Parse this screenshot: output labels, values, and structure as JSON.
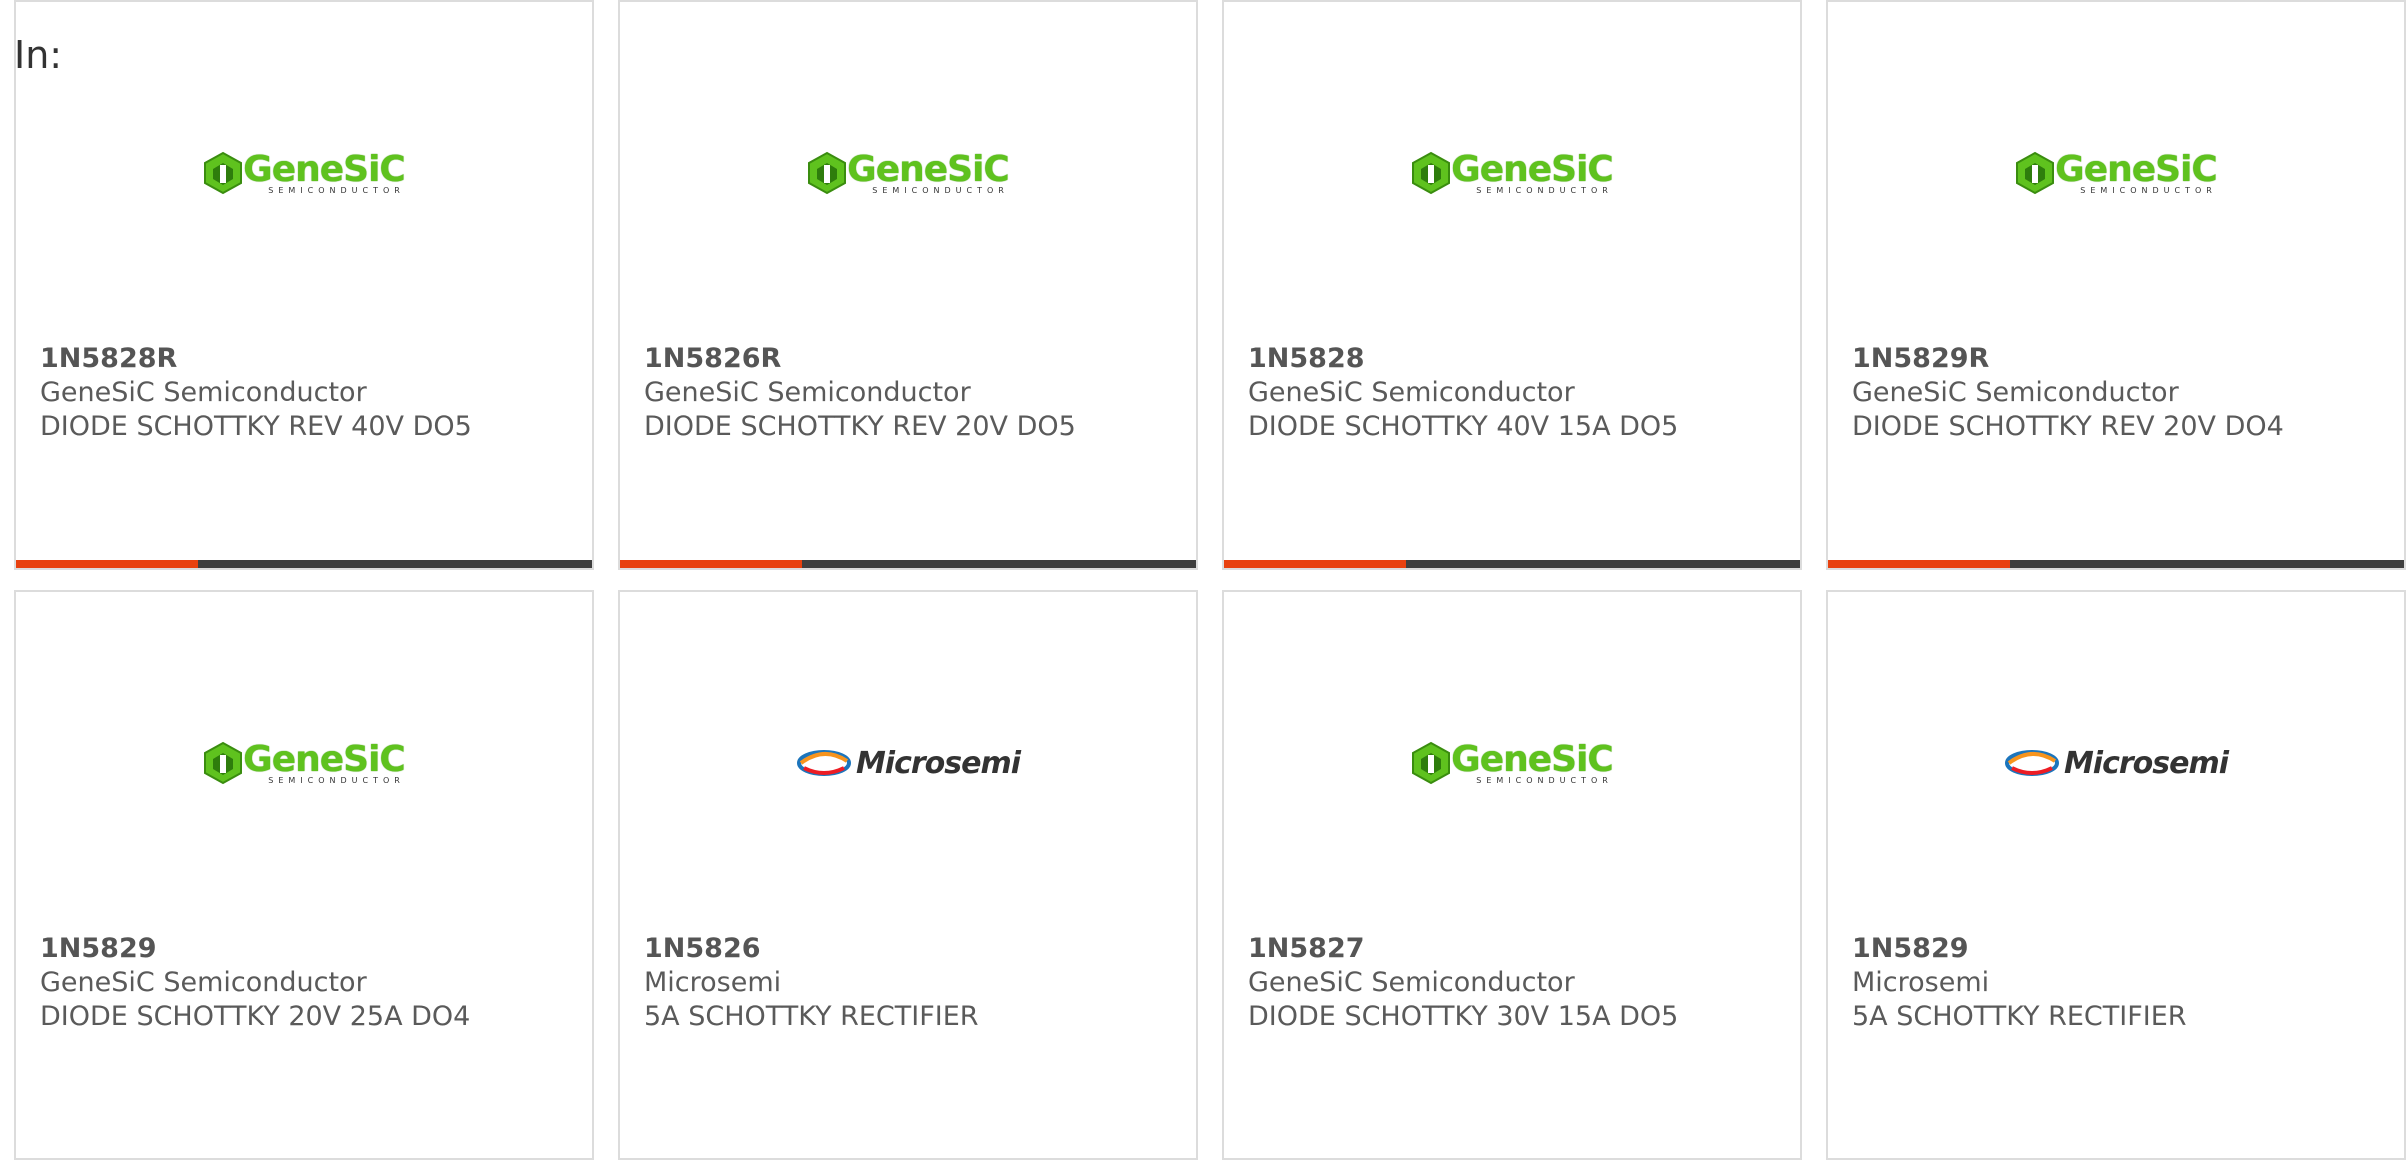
{
  "filter_label": "In:",
  "accent_color": "#e8410f",
  "bar_color": "#3f3f3f",
  "cards": [
    {
      "part": "1N5828R",
      "manufacturer": "GeneSiC Semiconductor",
      "description": "DIODE SCHOTTKY REV 40V DO5",
      "logo": "genesic-logo",
      "logo_text": "GeneSiC",
      "logo_sub": "SEMICONDUCTOR"
    },
    {
      "part": "1N5826R",
      "manufacturer": "GeneSiC Semiconductor",
      "description": "DIODE SCHOTTKY REV 20V DO5",
      "logo": "genesic-logo",
      "logo_text": "GeneSiC",
      "logo_sub": "SEMICONDUCTOR"
    },
    {
      "part": "1N5828",
      "manufacturer": "GeneSiC Semiconductor",
      "description": "DIODE SCHOTTKY 40V 15A DO5",
      "logo": "genesic-logo",
      "logo_text": "GeneSiC",
      "logo_sub": "SEMICONDUCTOR"
    },
    {
      "part": "1N5829R",
      "manufacturer": "GeneSiC Semiconductor",
      "description": "DIODE SCHOTTKY REV 20V DO4",
      "logo": "genesic-logo",
      "logo_text": "GeneSiC",
      "logo_sub": "SEMICONDUCTOR"
    },
    {
      "part": "1N5829",
      "manufacturer": "GeneSiC Semiconductor",
      "description": "DIODE SCHOTTKY 20V 25A DO4",
      "logo": "genesic-logo",
      "logo_text": "GeneSiC",
      "logo_sub": "SEMICONDUCTOR"
    },
    {
      "part": "1N5826",
      "manufacturer": "Microsemi",
      "description": "5A SCHOTTKY RECTIFIER",
      "logo": "microsemi-logo",
      "logo_text": "Microsemi",
      "logo_sub": ""
    },
    {
      "part": "1N5827",
      "manufacturer": "GeneSiC Semiconductor",
      "description": "DIODE SCHOTTKY 30V 15A DO5",
      "logo": "genesic-logo",
      "logo_text": "GeneSiC",
      "logo_sub": "SEMICONDUCTOR"
    },
    {
      "part": "1N5829",
      "manufacturer": "Microsemi",
      "description": "5A SCHOTTKY RECTIFIER",
      "logo": "microsemi-logo",
      "logo_text": "Microsemi",
      "logo_sub": ""
    }
  ]
}
